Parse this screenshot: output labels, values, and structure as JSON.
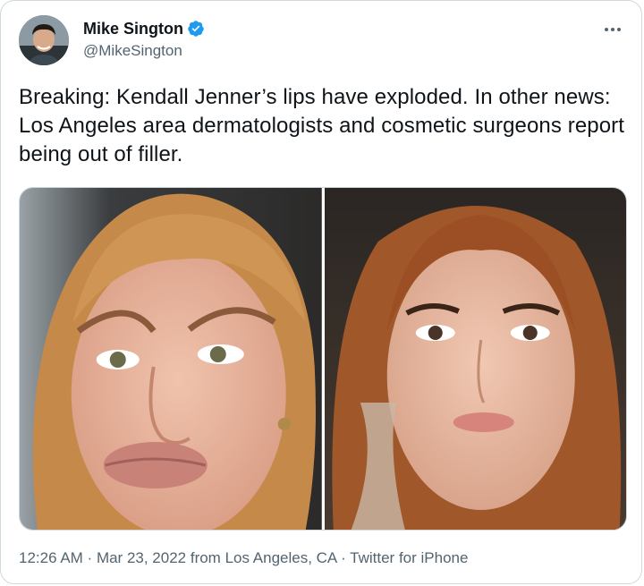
{
  "user": {
    "display_name": "Mike Sington",
    "handle": "@MikeSington",
    "verified": true,
    "avatar_icon": "avatar-photo"
  },
  "tweet": {
    "text": "Breaking: Kendall Jenner’s lips have exploded. In other news: Los Angeles area dermatologists and cosmetic surgeons report being out of filler.",
    "media": [
      {
        "icon": "photo-left"
      },
      {
        "icon": "photo-right"
      }
    ]
  },
  "meta": {
    "time": "12:26 AM",
    "sep1": " · ",
    "date": "Mar 23, 2022",
    "from_label": " from ",
    "location": "Los Angeles, CA",
    "sep2": " · ",
    "source": "Twitter for iPhone"
  },
  "colors": {
    "verified": "#1d9bf0",
    "text_primary": "#0f1419",
    "text_secondary": "#536471",
    "border": "#cfd9de"
  }
}
